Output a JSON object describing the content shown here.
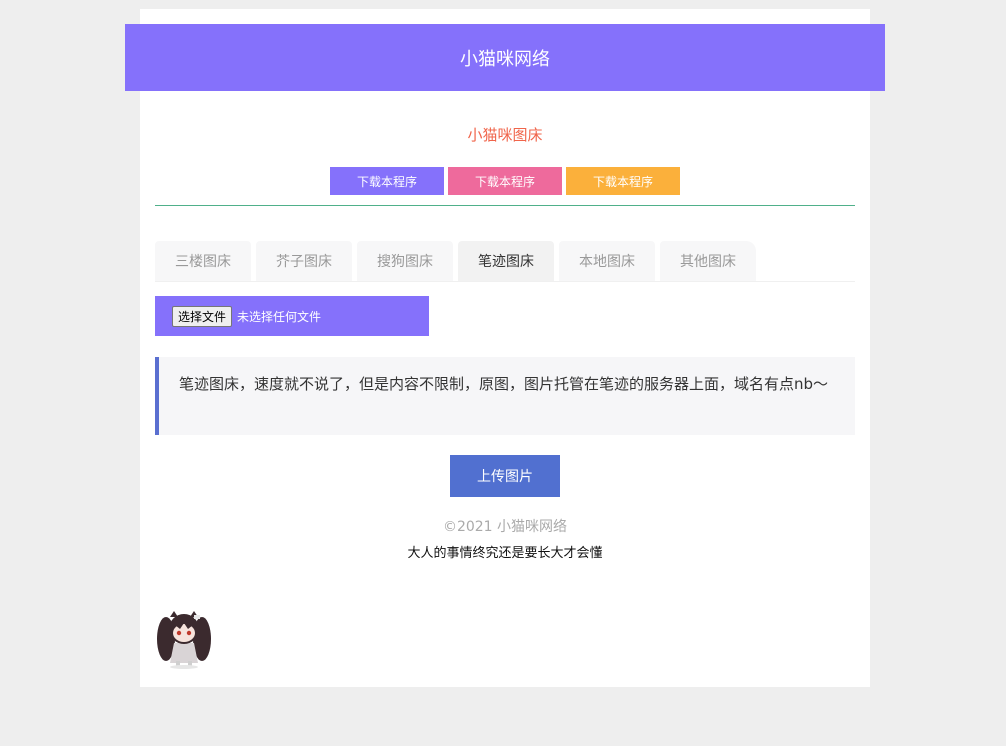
{
  "header": {
    "title": "小猫咪网络"
  },
  "subtitle": "小猫咪图床",
  "downloads": [
    {
      "label": "下载本程序",
      "color": "#8571fb"
    },
    {
      "label": "下载本程序",
      "color": "#ee6a9c"
    },
    {
      "label": "下载本程序",
      "color": "#fbb03b"
    }
  ],
  "tabs": [
    {
      "label": "三楼图床",
      "active": false
    },
    {
      "label": "芥子图床",
      "active": false
    },
    {
      "label": "搜狗图床",
      "active": false
    },
    {
      "label": "笔迹图床",
      "active": true
    },
    {
      "label": "本地图床",
      "active": false
    },
    {
      "label": "其他图床",
      "active": false
    }
  ],
  "file_input": {
    "button_label": "选择文件",
    "status": "未选择任何文件"
  },
  "notice": "笔迹图床，速度就不说了，但是内容不限制，原图，图片托管在笔迹的服务器上面，域名有点nb～",
  "upload_label": "上传图片",
  "footer": {
    "copyright": "©2021 小猫咪网络",
    "motto": "大人的事情终究还是要长大才会懂"
  },
  "colors": {
    "accent": "#8571fb",
    "upload": "#5170d0",
    "subtitle": "#f0654b"
  },
  "mascot_icon": "anime-girl-mascot-icon"
}
